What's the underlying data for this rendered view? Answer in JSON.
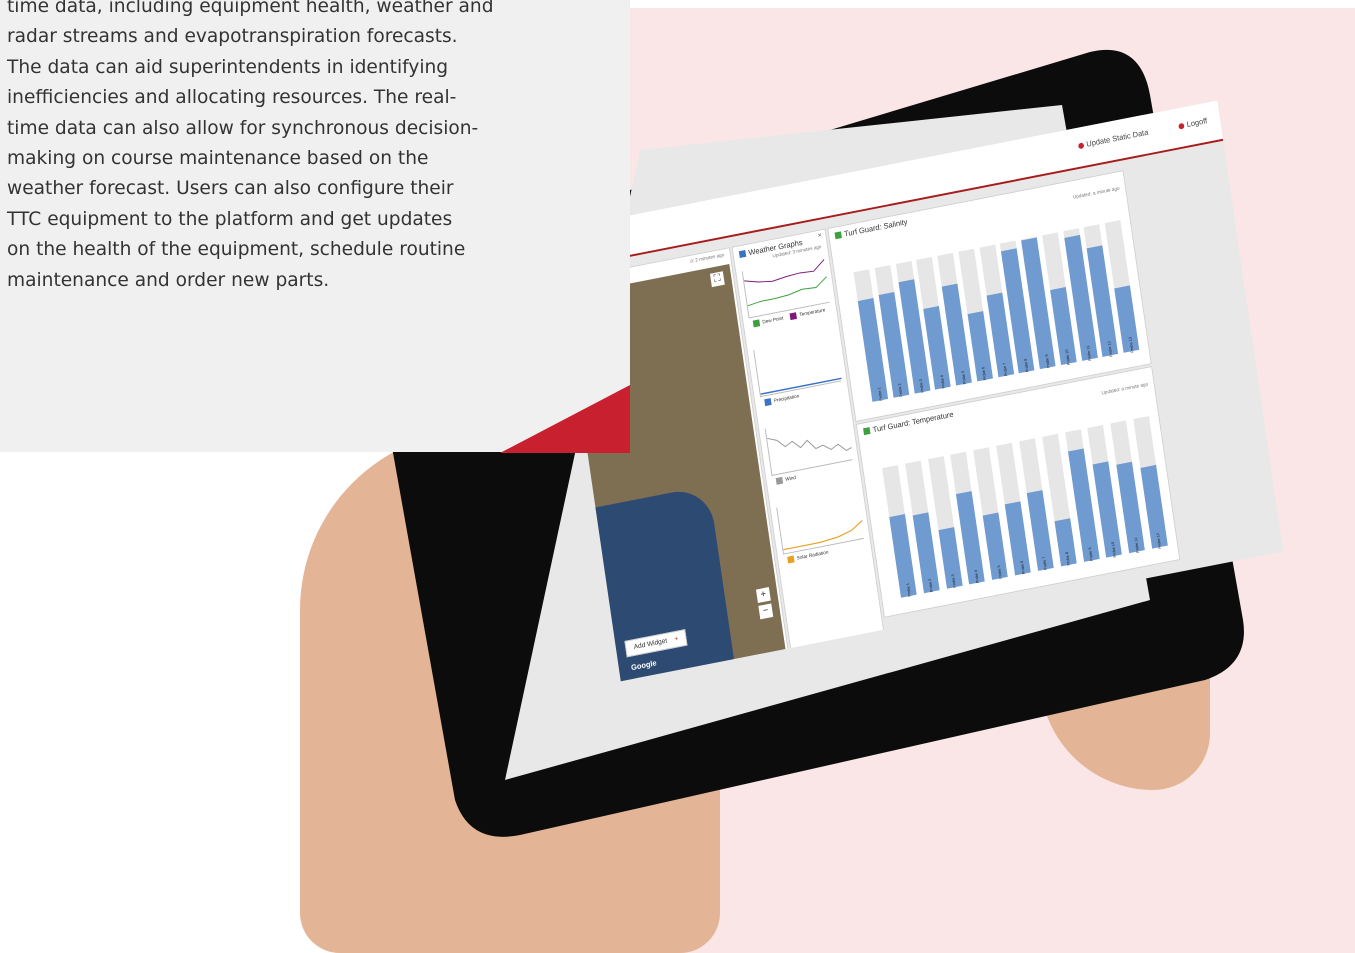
{
  "article": {
    "lines": [
      "time data, including equipment health, weather and",
      "radar streams and evapotranspiration forecasts.",
      "The data can aid superintendents in identifying",
      "inefficiencies and allocating resources. The real-",
      "time data can also allow for synchronous decision-",
      "making on course maintenance based on the",
      "weather forecast. Users can also configure their",
      "TTC equipment to the platform and get updates",
      "on the health of the equipment, schedule routine",
      "maintenance and order new parts."
    ]
  },
  "tablet": {
    "topbar": {
      "update_static": "Update Static Data",
      "logoff": "Logoff"
    },
    "map": {
      "updated": "d: 2 minutes ago",
      "google": "Google",
      "zoom_in": "+",
      "zoom_out": "−",
      "fullscreen": "⛶"
    },
    "weather": {
      "title": "Weather Graphs",
      "updated": "Updated: 3 minutes ago",
      "legend_dew": "Dew Point",
      "legend_temp": "Temperature",
      "legend_precip": "Precipitation",
      "legend_wind": "Wind",
      "legend_solar": "Solar Radiation"
    },
    "salinity": {
      "title": "Turf Guard: Salinity",
      "updated": "Updated: a minute ago",
      "bar_labels": [
        "Probe 1",
        "Probe 2",
        "Probe 3",
        "Probe 4",
        "Probe 5",
        "Probe 6",
        "Probe 7",
        "Probe 8",
        "Probe 9",
        "Probe 10",
        "Probe 11",
        "Probe 12",
        "Probe 13"
      ],
      "values": [
        0.78,
        0.79,
        0.86,
        0.62,
        0.76,
        0.52,
        0.63,
        0.94,
        0.99,
        0.58,
        0.95,
        0.84,
        0.5
      ]
    },
    "temperature": {
      "title": "Turf Guard: Temperature",
      "updated": "Updated: a minute ago",
      "bar_labels": [
        "Probe 1",
        "Probe 2",
        "Probe 3",
        "Probe 4",
        "Probe 5",
        "Probe 6",
        "Probe 7",
        "Probe 8",
        "Probe 9",
        "Probe 10",
        "Probe 11",
        "Probe 12"
      ],
      "values": [
        0.62,
        0.6,
        0.45,
        0.7,
        0.5,
        0.55,
        0.6,
        0.35,
        0.85,
        0.72,
        0.68,
        0.62
      ]
    },
    "add_widget": "Add Widget",
    "add_icon": "+",
    "close_icon": "×"
  },
  "colors": {
    "accent_red": "#c8202f",
    "bar_blue": "#6f9bd1",
    "background_pink": "#fae6e6"
  }
}
